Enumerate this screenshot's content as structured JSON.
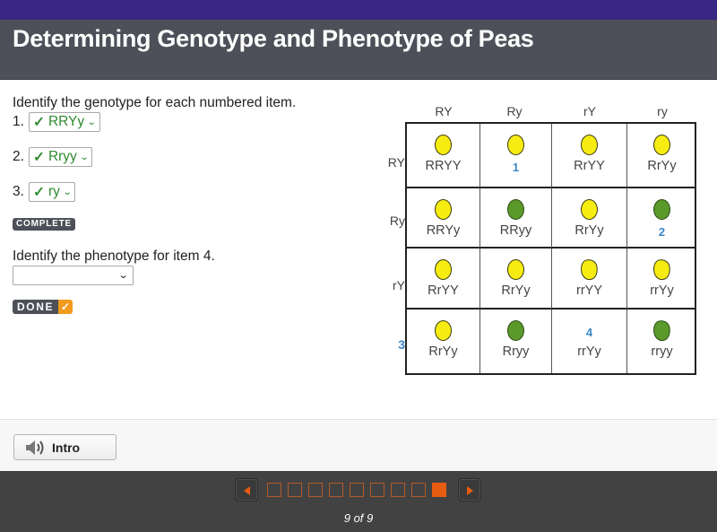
{
  "header": {
    "title": "Determining Genotype and Phenotype of Peas",
    "topbar_color": "#382884",
    "titlebar_color": "#4d5058"
  },
  "questions": {
    "genotype_prompt": "Identify the genotype for each numbered item.",
    "items": [
      {
        "number": "1.",
        "value": "RRYy",
        "status": "correct",
        "check": "✓"
      },
      {
        "number": "2.",
        "value": "Rryy",
        "status": "correct",
        "check": "✓"
      },
      {
        "number": "3.",
        "value": "ry",
        "status": "correct",
        "check": "✓"
      }
    ],
    "complete_badge": "COMPLETE",
    "phenotype_prompt": "Identify the phenotype for item 4.",
    "phenotype_select": {
      "value": ""
    },
    "done_label": "DONE",
    "done_check": "✓",
    "correct_color": "#2f8a2f",
    "done_accent": "#f29a1d"
  },
  "punnett": {
    "col_headers": [
      "RY",
      "Ry",
      "rY",
      "ry"
    ],
    "row_headers": [
      {
        "label": "RY",
        "highlight": false
      },
      {
        "label": "Ry",
        "highlight": false
      },
      {
        "label": "rY",
        "highlight": false
      },
      {
        "label": "3",
        "highlight": true
      }
    ],
    "rows": [
      [
        {
          "pea": "yellow-round",
          "label": "RRYY",
          "numbered": false
        },
        {
          "pea": "yellow-round",
          "label": "1",
          "numbered": true
        },
        {
          "pea": "yellow-round",
          "label": "RrYY",
          "numbered": false
        },
        {
          "pea": "yellow-round",
          "label": "RrYy",
          "numbered": false
        }
      ],
      [
        {
          "pea": "yellow-round",
          "label": "RRYy",
          "numbered": false
        },
        {
          "pea": "green-round",
          "label": "RRyy",
          "numbered": false
        },
        {
          "pea": "yellow-round",
          "label": "RrYy",
          "numbered": false
        },
        {
          "pea": "green-round",
          "label": "2",
          "numbered": true
        }
      ],
      [
        {
          "pea": "yellow-round",
          "label": "RrYY",
          "numbered": false
        },
        {
          "pea": "yellow-round",
          "label": "RrYy",
          "numbered": false
        },
        {
          "pea": "yellow-wrinkled",
          "label": "rrYY",
          "numbered": false
        },
        {
          "pea": "yellow-wrinkled",
          "label": "rrYy",
          "numbered": false
        }
      ],
      [
        {
          "pea": "yellow-round",
          "label": "RrYy",
          "numbered": false
        },
        {
          "pea": "green-round",
          "label": "Rryy",
          "numbered": false
        },
        {
          "pea": "none",
          "label": "rrYy",
          "numbered": false,
          "item_number": "4"
        },
        {
          "pea": "green-wrinkled",
          "label": "rryy",
          "numbered": false
        }
      ]
    ],
    "colors": {
      "yellow": "#f7ec12",
      "green": "#5b9a2a",
      "number": "#3a86c8"
    }
  },
  "footer": {
    "intro_button": {
      "label": "Intro",
      "icon": "speaker-icon"
    }
  },
  "navigation": {
    "total_pages": 9,
    "current_page": 9,
    "page_label": "9 of 9",
    "prev_icon": "prev-arrow-icon",
    "next_icon": "next-arrow-icon",
    "accent": "#e65c10"
  }
}
